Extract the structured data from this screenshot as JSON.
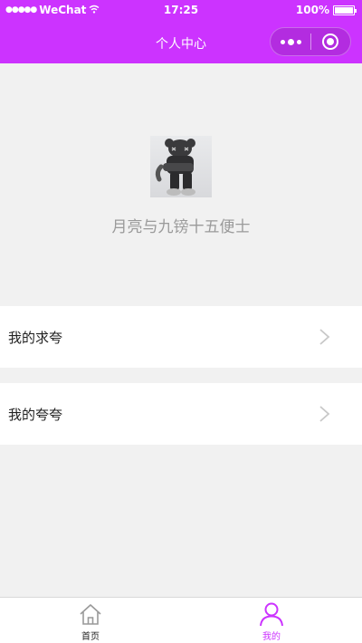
{
  "status_bar": {
    "carrier": "WeChat",
    "time": "17:25",
    "battery": "100%"
  },
  "nav": {
    "title": "个人中心"
  },
  "profile": {
    "username": "月亮与九镑十五便士"
  },
  "menu": [
    {
      "label": "我的求夸",
      "icon": "chevron-right-icon"
    },
    {
      "label": "我的夸夸",
      "icon": "chevron-right-icon"
    }
  ],
  "tabbar": [
    {
      "label": "首页",
      "icon": "home-icon",
      "active": false
    },
    {
      "label": "我的",
      "icon": "user-icon",
      "active": true
    }
  ],
  "colors": {
    "accent": "#cc33ff",
    "background": "#f1f1f1"
  }
}
